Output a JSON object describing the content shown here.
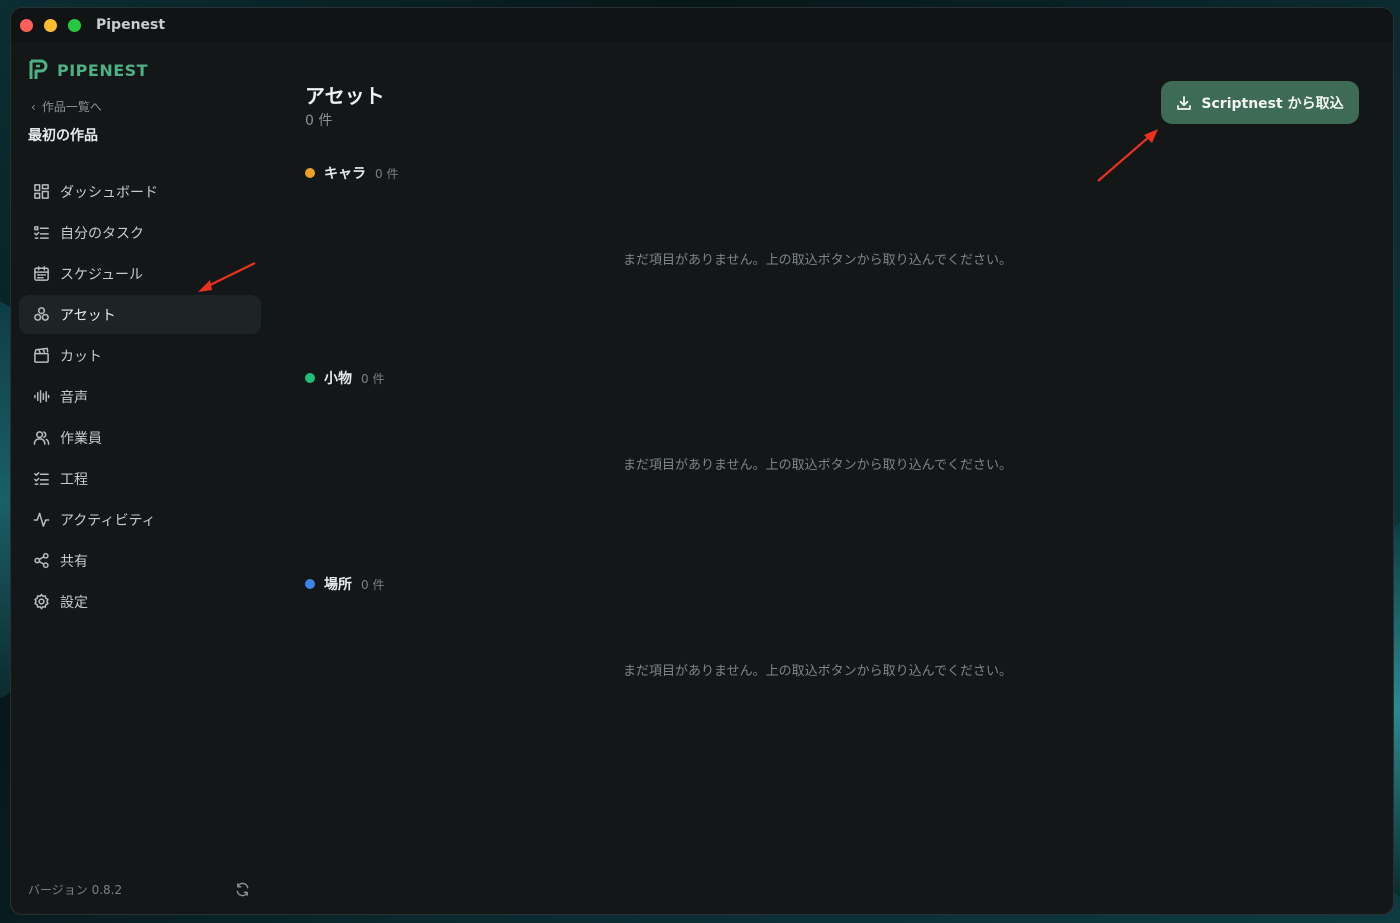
{
  "window": {
    "title": "Pipenest"
  },
  "sidebar": {
    "brand": "PIPENEST",
    "back_label": "作品一覧へ",
    "project_name": "最初の作品",
    "items": [
      {
        "label": "ダッシュボード",
        "icon": "dashboard-icon"
      },
      {
        "label": "自分のタスク",
        "icon": "task-list-icon"
      },
      {
        "label": "スケジュール",
        "icon": "calendar-icon"
      },
      {
        "label": "アセット",
        "icon": "assets-icon",
        "active": true
      },
      {
        "label": "カット",
        "icon": "clapperboard-icon"
      },
      {
        "label": "音声",
        "icon": "audio-waveform-icon"
      },
      {
        "label": "作業員",
        "icon": "users-icon"
      },
      {
        "label": "工程",
        "icon": "checklist-icon"
      },
      {
        "label": "アクティビティ",
        "icon": "activity-icon"
      },
      {
        "label": "共有",
        "icon": "share-icon"
      },
      {
        "label": "設定",
        "icon": "gear-icon"
      }
    ],
    "version": "バージョン 0.8.2"
  },
  "main": {
    "title": "アセット",
    "count": "0 件",
    "import_button": "Scriptnest から取込",
    "sections": [
      {
        "name": "キャラ",
        "count": "0 件",
        "color": "#f0a020",
        "empty": "まだ項目がありません。上の取込ボタンから取り込んでください。"
      },
      {
        "name": "小物",
        "count": "0 件",
        "color": "#1fbf7a",
        "empty": "まだ項目がありません。上の取込ボタンから取り込んでください。"
      },
      {
        "name": "場所",
        "count": "0 件",
        "color": "#3a86e8",
        "empty": "まだ項目がありません。上の取込ボタンから取り込んでください。"
      }
    ]
  },
  "colors": {
    "accent": "#3d6b56",
    "brand": "#4fb083",
    "annotation": "#e8321e"
  }
}
